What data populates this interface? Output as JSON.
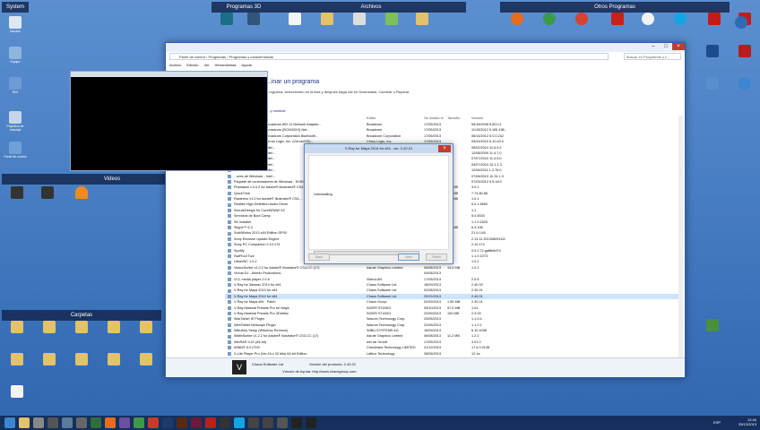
{
  "desktop": {
    "groups": [
      "System",
      "Programas 3D",
      "Archivos",
      "Otros Programas",
      "Videos",
      "Carpetas"
    ],
    "left_icons": [
      "Usuario",
      "Equipo",
      "Red",
      "Papelera de reciclaje",
      "Panel de control"
    ],
    "right_icons": [
      "Google Earth",
      "SketchUp",
      "Internet Explorer",
      "Mis Sitios"
    ]
  },
  "window": {
    "address": "Panel de control › Programas › Programas y características",
    "search": "Buscar en Programas y c...",
    "menu": [
      "Archivo",
      "Edición",
      "Ver",
      "Herramientas",
      "Ayuda"
    ],
    "heading": "...inar un programa",
    "subtitle": "...rograma, selecciónelo en la lista y después haga clic en Desinstalar, Cambiar o Reparar.",
    "organize": "... y cambiar",
    "columns": [
      "Editor",
      "Se instaló el",
      "Tamaño",
      "Versión"
    ],
    "rows": [
      [
        "...ores de Windows - Broadcom 802.11 Network Adapter...",
        "Broadcom",
        "17/05/2013",
        "",
        "06/18/2008 5.60.0.1"
      ],
      [
        "...ores de Windows - Broadcom (BCM43XX) Net...",
        "Broadcom",
        "17/05/2013",
        "",
        "11/15/2012 5.106.198..."
      ],
      [
        "...ores de Windows - Broadcom Corporation Bluetooth...",
        "Broadcom Corporation",
        "17/05/2013",
        "",
        "06/14/2012 5.0.0.242"
      ],
      [
        "...ores de Windows - Cirrus Logic, Inc. (CirrusVSS)...",
        "Cirrus Logic, Inc.",
        "17/05/2013",
        "",
        "09/24/2010 6.10.43.0"
      ],
      [
        "...ores de Windows - Intel...",
        "",
        "",
        "",
        "05/02/2010 11.6.0.2"
      ],
      [
        "...ores de Windows - Intel...",
        "",
        "",
        "",
        "12/08/2009 11.4.7.0"
      ],
      [
        "...ores de Windows - Intel...",
        "",
        "",
        "",
        "07/07/2010 11.4.5.0"
      ],
      [
        "...ores de Windows - Intel...",
        "",
        "",
        "",
        "04/07/2010 10.1.1.3"
      ],
      [
        "...ores de Windows - Intel...",
        "",
        "",
        "",
        "12/06/2011 1.2.76.0"
      ],
      [
        "...ores de Windows - Intel...",
        "",
        "",
        "",
        "07/08/2010 10.31.1.3"
      ],
      [
        "Paquete de controladores de Windows - NVIDIA...",
        "",
        "",
        "",
        "07/03/2012 5.5.18.0"
      ],
      [
        "Phantasm v.3.0.2 for Adobe® Illustrator® CS4...",
        "",
        "",
        "4.6 MB",
        "3.0.2"
      ],
      [
        "QuickTime",
        "",
        "",
        "7.6 MB",
        "7.74.80.86"
      ],
      [
        "Rasterino v1.0 for Adobe® Illustrator® CS4...",
        "",
        "",
        "0.8 MB",
        "1.0.1"
      ],
      [
        "Realtek High Definition Audio Driver",
        "",
        "",
        "",
        "6.0.1.5690"
      ],
      [
        "SecureDesign for CorelDRAW X3",
        "",
        "",
        "",
        "1.1"
      ],
      [
        "Servicios de Boot Camp",
        "",
        "",
        "",
        "5.0.5033"
      ],
      [
        "SK Installer",
        "",
        "",
        "",
        "1.1.0.1620"
      ],
      [
        "Skype™ 6.3",
        "",
        "",
        "2.6 MB",
        "6.3.106"
      ],
      [
        "SolidWorks 2013 x64 Edition SP00",
        "",
        "",
        "",
        "21.0.0.60"
      ],
      [
        "Sony Ericsson Update Engine",
        "",
        "",
        "",
        "2.13.11.201308091111"
      ],
      [
        "Sony PC Companion 2.10.174",
        "",
        "",
        "",
        "2.10.174"
      ],
      [
        "Spotify",
        "",
        "",
        "",
        "0.9.2.72.gaf8b6d74"
      ],
      [
        "SwiFtool Tool",
        "",
        "",
        "",
        "1.1.0.1073"
      ],
      [
        "UltraVNC 1.0.2",
        "",
        "",
        "",
        "1.0.2"
      ],
      [
        "VectorScribe v1.0.2 for Adobe® Illustrator® CS4-CC (17)",
        "Astute Graphics Limited",
        "06/08/2013",
        "14.5 MB",
        "1.0.2"
      ],
      [
        "Virtual DJ - Atomix Productions",
        "",
        "04/08/2013",
        "",
        ""
      ],
      [
        "VLC media player 2.0.6",
        "VideoLAN",
        "17/05/2013",
        "",
        "2.0.6"
      ],
      [
        "V-Ray for 3dsmax 2014 for x64",
        "Chaos Software Ltd",
        "18/09/2013",
        "",
        "2.40.03"
      ],
      [
        "V-Ray for Maya 2013 for x64",
        "Chaos Software Ltd",
        "02/08/2013",
        "",
        "2.30.01"
      ],
      [
        "V-Ray for Maya 2014 for x64",
        "Chaos Software Ltd",
        "25/12/2013",
        "",
        "2.40.01"
      ],
      [
        "V-Ray for Maya x64 - Patch",
        "Chaos Group",
        "02/09/2013",
        "1.55 MB",
        "2.30.01"
      ],
      [
        "V-Ray Material Presets Pro for Maya",
        "SIGER STUDIO",
        "09/10/2013",
        "37.5 MB",
        "1.01"
      ],
      [
        "V-Ray Material Presets Pro 3DsMax",
        "SIGER STUDIO",
        "22/09/2013",
        "100 MB",
        "2.3.09"
      ],
      [
        "WacTablet IE Plugin",
        "Wacom Technology Corp.",
        "23/05/2013",
        "",
        "1.1.0.4"
      ],
      [
        "WebTablet Netscape Plugin",
        "Wacom Technology Corp.",
        "22/05/2013",
        "",
        "1.1.0.1"
      ],
      [
        "WibuKey Setup (WibuKey Remove)",
        "WIBU-SYSTEMS AG",
        "18/09/2013",
        "",
        "6.10.1098"
      ],
      [
        "WidthScribe v1.2.2 for Adobe® Illustrator® CS3-CC (17)",
        "Astute Graphics Limited",
        "06/08/2013",
        "11.2 MB",
        "1.2.2"
      ],
      [
        "WinRAR 4.01 (64-bit)",
        "win.rar GmbH",
        "17/05/2013",
        "",
        "4.01.0"
      ],
      [
        "WINMT 6.0.2709",
        "Checkhard Technology LIMITED",
        "21/12/2013",
        "",
        "17.6.0.0138"
      ],
      [
        "X-Lite Player Pro (Ver.16.x 32 bits) 64-bit Edition",
        "Lattice Technology",
        "28/06/2013",
        "",
        "12.1a"
      ]
    ],
    "details_company": "Chaos Software Ltd",
    "details_version_label": "Versión del producto: 2.40.01",
    "details_help": "Vínculo de Ayuda: http://www.chaosgroup.com"
  },
  "dialog": {
    "title": "V-Ray for Maya 2014 for x64 - ver. 2.40.01",
    "status": "Uninstalling",
    "buttons": [
      "Back",
      "Next",
      "Finish"
    ],
    "progress": 0.0
  },
  "taskbar": {
    "language": "ESP",
    "time": "12:40",
    "date": "25/12/2013"
  },
  "colors": {
    "title": "#1e3287",
    "taskbar": "#15305e",
    "close": "#c43b2f"
  }
}
